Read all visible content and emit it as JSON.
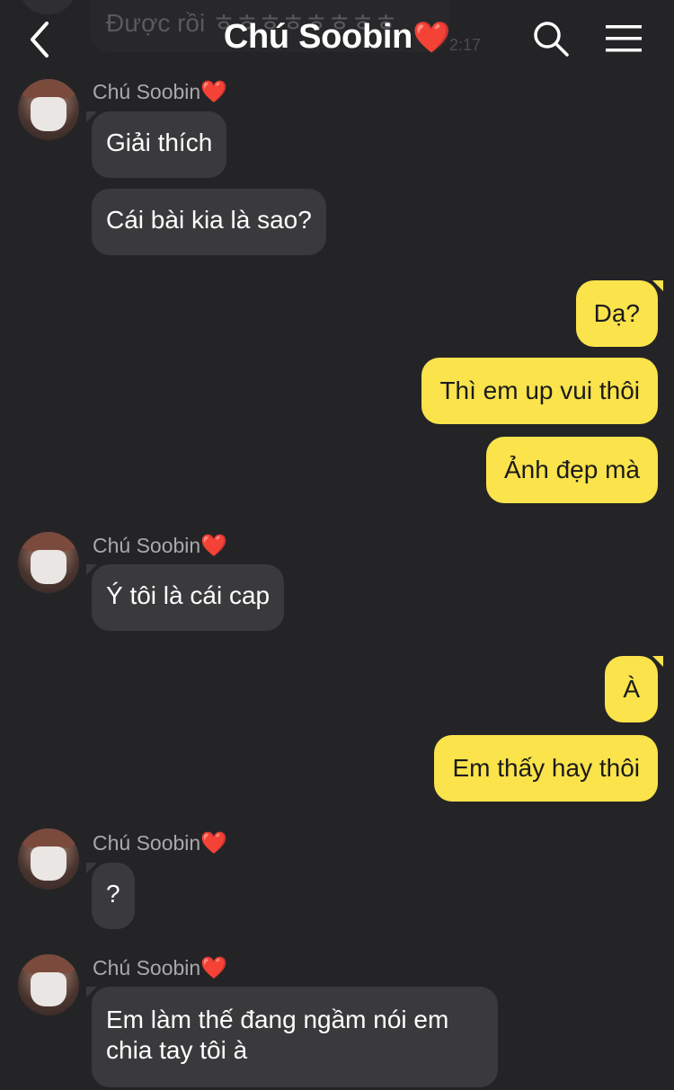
{
  "header": {
    "title": "Chú Soobin",
    "title_heart": "❤️",
    "back_icon": "chevron-left-icon",
    "search_icon": "search-icon",
    "menu_icon": "hamburger-menu-icon"
  },
  "previous": {
    "text": "Được rồi ㅎㅎㅎㅎㅎㅎㅎㅎ",
    "time": "2:17"
  },
  "sender_name": "Chú Soobin",
  "sender_heart": "❤️",
  "messages": {
    "m1": "Giải thích",
    "m2": "Cái bài kia là sao?",
    "m3": "Dạ?",
    "m4": "Thì em up vui thôi",
    "m5": "Ảnh đẹp mà",
    "m6": "Ý tôi là cái cap",
    "m7": "À",
    "m8": "Em thấy hay thôi",
    "m9": "?",
    "m10": "Em làm thế đang ngầm nói em chia tay tôi à"
  },
  "colors": {
    "background": "#242426",
    "incoming_bubble": "#3a3a3c",
    "outgoing_bubble": "#fae34b",
    "sender_name": "#a9a9ad"
  }
}
